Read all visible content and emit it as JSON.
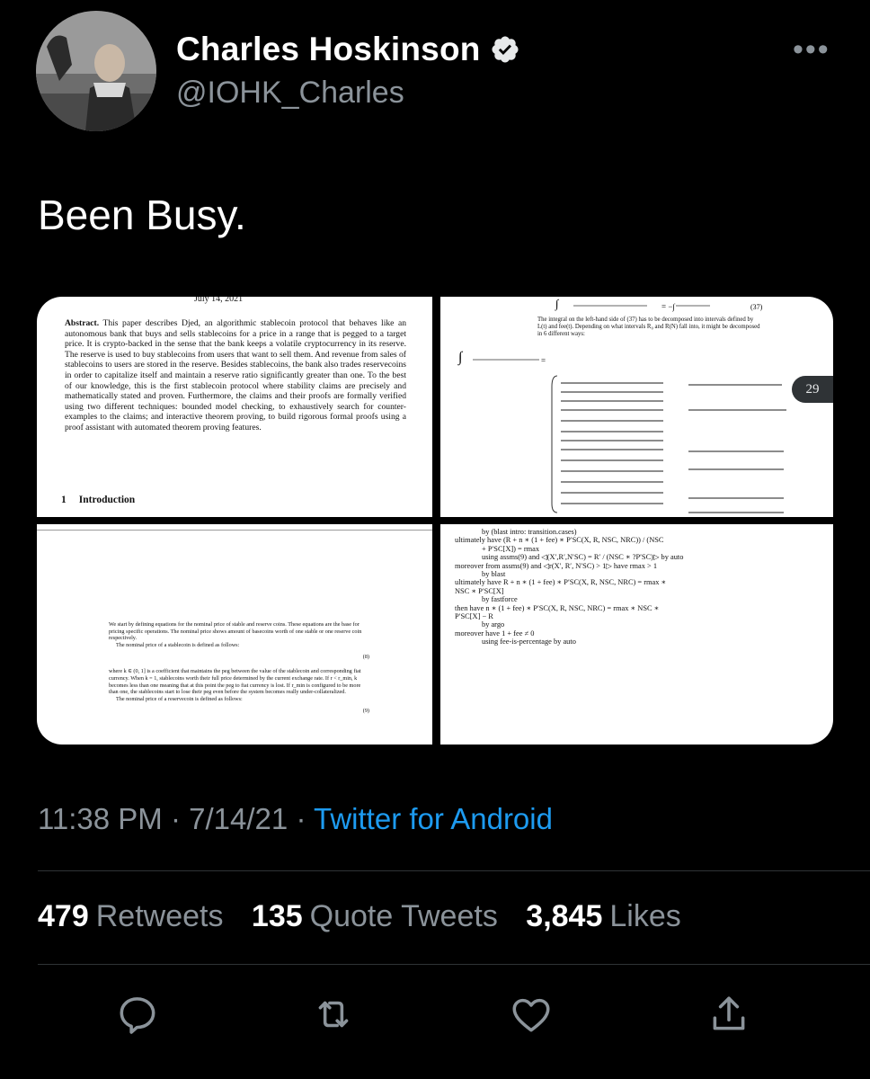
{
  "author": {
    "display_name": "Charles Hoskinson",
    "handle": "@IOHK_Charles",
    "verified": true
  },
  "more_icon": "more-dots-icon",
  "tweet_text": "Been Busy.",
  "media": {
    "badge_count": "29",
    "panel1": {
      "date": "July 14, 2021",
      "abstract_label": "Abstract.",
      "abstract_text": "This paper describes Djed, an algorithmic stablecoin protocol that behaves like an autonomous bank that buys and sells stablecoins for a price in a range that is pegged to a target price. It is crypto-backed in the sense that the bank keeps a volatile cryptocurrency in its reserve. The reserve is used to buy stablecoins from users that want to sell them. And revenue from sales of stablecoins to users are stored in the reserve. Besides stablecoins, the bank also trades reservecoins in order to capitalize itself and maintain a reserve ratio significantly greater than one. To the best of our knowledge, this is the first stablecoin protocol where stability claims are precisely and mathematically stated and proven. Furthermore, the claims and their proofs are formally verified using two different techniques: bounded model checking, to exhaustively search for counter-examples to the claims; and interactive theorem proving, to build rigorous formal proofs using a proof assistant with automated theorem proving features.",
      "section_number": "1",
      "section_title": "Introduction"
    },
    "panel2": {
      "eq_number": "(37)",
      "text": "The integral on the left-hand side of (37) has to be decomposed into intervals defined by L(t) and fee(t). Depending on what intervals R₀ and R(N) fall into, it might be decomposed in 6 different ways:"
    },
    "panel3": {
      "text1": "We start by defining equations for the nominal price of stable and reserve coins. These equations are the base for pricing specific operations. The nominal price shows amount of basecoins worth of one stable or one reserve coin respectively.",
      "text2": "The nominal price of a stablecoin is defined as follows:",
      "text3": "where k ∈ (0, 1] is a coefficient that maintains the peg between the value of the stablecoin and corresponding fiat currency. When k = 1, stablecoins worth their full price determined by the current exchange rate. If r < r_min, k becomes less than one meaning that at this point the peg to fiat currency is lost. If r_min is configured to be more than one, the stablecoins start to lose their peg even before the system becomes really under-collateralized.",
      "text4": "The nominal price of a reservecoin is defined as follows:",
      "eq8": "(8)",
      "eq9": "(9)"
    },
    "panel4": {
      "lines": [
        "by (blast intro: transition.cases)",
        "ultimately have (R + n ∗ (1 + fee) ∗ P′SC(X, R, NSC, NRC)) / (NSC",
        "+ P′SC[X]) = rmax",
        "using assms(9) and ◁(X′,R′,N′SC) = R′ / (NSC ∗ ?P′SC)▷ by auto",
        "moreover from assms(9) and ◁r(X′, R′, N′SC) > 1▷ have rmax > 1",
        "by blast",
        "ultimately have R + n ∗ (1 + fee) ∗ P′SC(X, R, NSC, NRC) = rmax ∗",
        "NSC ∗ P′SC[X]",
        "by fastforce",
        "then have n ∗ (1 + fee) ∗ P′SC(X, R, NSC, NRC) = rmax ∗ NSC ∗",
        "P′SC[X] − R",
        "by argo",
        "moreover have 1 + fee ≠ 0",
        "using fee-is-percentage by auto"
      ]
    }
  },
  "timestamp": {
    "time": "11:38 PM",
    "separator": "·",
    "date": "7/14/21",
    "source": "Twitter for Android"
  },
  "stats": {
    "retweets_count": "479",
    "retweets_label": "Retweets",
    "quotes_count": "135",
    "quotes_label": "Quote Tweets",
    "likes_count": "3,845",
    "likes_label": "Likes"
  },
  "actions": [
    "reply-icon",
    "retweet-icon",
    "like-icon",
    "share-icon"
  ],
  "colors": {
    "background": "#000000",
    "text": "#ffffff",
    "secondary": "#8b939a",
    "link": "#1d9bf0",
    "divider": "#2f3336"
  }
}
